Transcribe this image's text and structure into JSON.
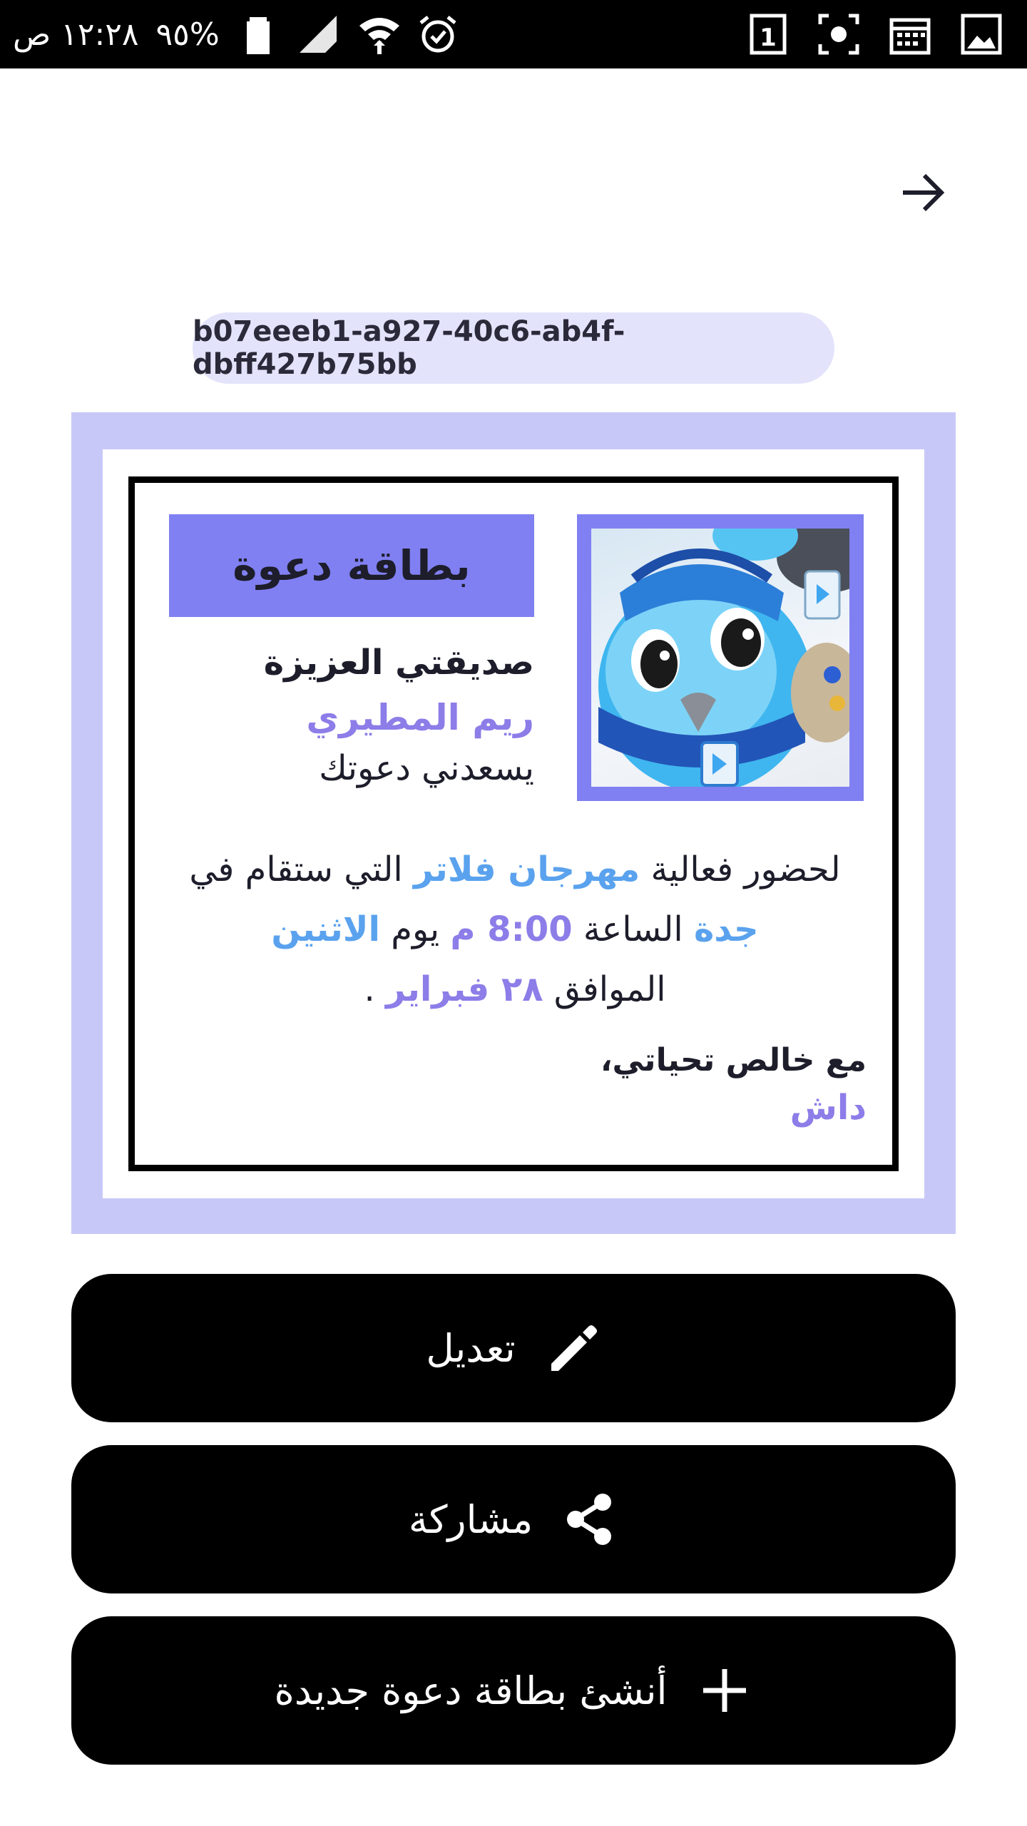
{
  "status_bar": {
    "time": "١٢:٢٨ ص",
    "battery": "%٩٥",
    "icons": [
      "battery-icon",
      "signal-icon",
      "wifi-icon",
      "alarm-icon",
      "sim-1-icon",
      "screenshot-icon",
      "calendar-icon",
      "image-icon"
    ]
  },
  "header": {
    "back_icon": "arrow-right-icon"
  },
  "card": {
    "id": "b07eeeb1-a927-40c6-ab4f-dbff427b75bb",
    "title": "بطاقة دعوة",
    "greeting": "صديقتي العزيزة",
    "recipient_name": "ريم المطيري",
    "invite_line": "يسعدني دعوتك",
    "body": {
      "p1": "لحضور فعالية ",
      "event_name": "مهرجان فلاتر",
      "p2": " التي ستقام في ",
      "city": "جدة",
      "p3": " الساعة ",
      "time": "8:00 م",
      "p4": " يوم ",
      "day": "الاثنين",
      "p5": " الموافق ",
      "date": "٢٨ فبراير",
      "p6": " ."
    },
    "closing": "مع خالص تحياتي،",
    "sender": "داش",
    "colors": {
      "outer": "#c8c8f8",
      "accent": "#8080f2",
      "blue_highlight": "#5aa2ee",
      "purple_highlight": "#8c7de8"
    }
  },
  "actions": {
    "edit_label": "تعديل",
    "share_label": "مشاركة",
    "new_label": "أنشئ بطاقة دعوة جديدة"
  }
}
